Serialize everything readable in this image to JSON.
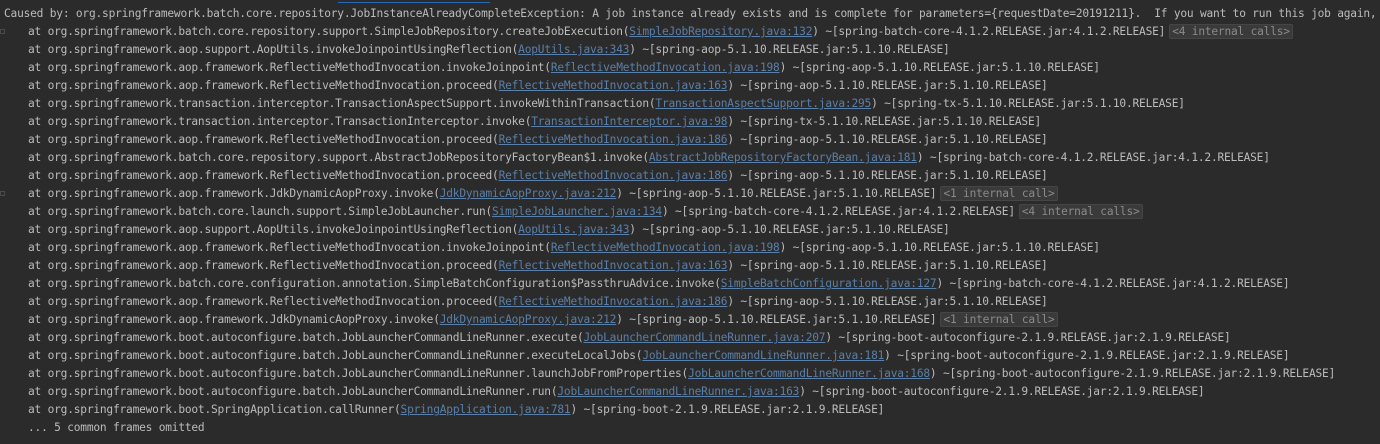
{
  "header": {
    "caused_by": "Caused by: org.springframework.batch.core.repository.JobInstanceAlreadyCompleteException: A job instance already exists and is complete for parameters={requestDate=20191211}.  If you want to run this job again, change the parameters."
  },
  "frames": [
    {
      "method": "at org.springframework.batch.core.repository.support.SimpleJobRepository.createJobExecution(",
      "link": "SimpleJobRepository.java:132",
      "jar": ") ~[spring-batch-core-4.1.2.RELEASE.jar:4.1.2.RELEASE]",
      "internal": "<4 internal calls>"
    },
    {
      "method": "at org.springframework.aop.support.AopUtils.invokeJoinpointUsingReflection(",
      "link": "AopUtils.java:343",
      "jar": ") ~[spring-aop-5.1.10.RELEASE.jar:5.1.10.RELEASE]",
      "internal": ""
    },
    {
      "method": "at org.springframework.aop.framework.ReflectiveMethodInvocation.invokeJoinpoint(",
      "link": "ReflectiveMethodInvocation.java:198",
      "jar": ") ~[spring-aop-5.1.10.RELEASE.jar:5.1.10.RELEASE]",
      "internal": ""
    },
    {
      "method": "at org.springframework.aop.framework.ReflectiveMethodInvocation.proceed(",
      "link": "ReflectiveMethodInvocation.java:163",
      "jar": ") ~[spring-aop-5.1.10.RELEASE.jar:5.1.10.RELEASE]",
      "internal": ""
    },
    {
      "method": "at org.springframework.transaction.interceptor.TransactionAspectSupport.invokeWithinTransaction(",
      "link": "TransactionAspectSupport.java:295",
      "jar": ") ~[spring-tx-5.1.10.RELEASE.jar:5.1.10.RELEASE]",
      "internal": ""
    },
    {
      "method": "at org.springframework.transaction.interceptor.TransactionInterceptor.invoke(",
      "link": "TransactionInterceptor.java:98",
      "jar": ") ~[spring-tx-5.1.10.RELEASE.jar:5.1.10.RELEASE]",
      "internal": ""
    },
    {
      "method": "at org.springframework.aop.framework.ReflectiveMethodInvocation.proceed(",
      "link": "ReflectiveMethodInvocation.java:186",
      "jar": ") ~[spring-aop-5.1.10.RELEASE.jar:5.1.10.RELEASE]",
      "internal": ""
    },
    {
      "method": "at org.springframework.batch.core.repository.support.AbstractJobRepositoryFactoryBean$1.invoke(",
      "link": "AbstractJobRepositoryFactoryBean.java:181",
      "jar": ") ~[spring-batch-core-4.1.2.RELEASE.jar:4.1.2.RELEASE]",
      "internal": ""
    },
    {
      "method": "at org.springframework.aop.framework.ReflectiveMethodInvocation.proceed(",
      "link": "ReflectiveMethodInvocation.java:186",
      "jar": ") ~[spring-aop-5.1.10.RELEASE.jar:5.1.10.RELEASE]",
      "internal": ""
    },
    {
      "method": "at org.springframework.aop.framework.JdkDynamicAopProxy.invoke(",
      "link": "JdkDynamicAopProxy.java:212",
      "jar": ") ~[spring-aop-5.1.10.RELEASE.jar:5.1.10.RELEASE]",
      "internal": "<1 internal call>"
    },
    {
      "method": "at org.springframework.batch.core.launch.support.SimpleJobLauncher.run(",
      "link": "SimpleJobLauncher.java:134",
      "jar": ") ~[spring-batch-core-4.1.2.RELEASE.jar:4.1.2.RELEASE]",
      "internal": "<4 internal calls>"
    },
    {
      "method": "at org.springframework.aop.support.AopUtils.invokeJoinpointUsingReflection(",
      "link": "AopUtils.java:343",
      "jar": ") ~[spring-aop-5.1.10.RELEASE.jar:5.1.10.RELEASE]",
      "internal": ""
    },
    {
      "method": "at org.springframework.aop.framework.ReflectiveMethodInvocation.invokeJoinpoint(",
      "link": "ReflectiveMethodInvocation.java:198",
      "jar": ") ~[spring-aop-5.1.10.RELEASE.jar:5.1.10.RELEASE]",
      "internal": ""
    },
    {
      "method": "at org.springframework.aop.framework.ReflectiveMethodInvocation.proceed(",
      "link": "ReflectiveMethodInvocation.java:163",
      "jar": ") ~[spring-aop-5.1.10.RELEASE.jar:5.1.10.RELEASE]",
      "internal": ""
    },
    {
      "method": "at org.springframework.batch.core.configuration.annotation.SimpleBatchConfiguration$PassthruAdvice.invoke(",
      "link": "SimpleBatchConfiguration.java:127",
      "jar": ") ~[spring-batch-core-4.1.2.RELEASE.jar:4.1.2.RELEASE]",
      "internal": ""
    },
    {
      "method": "at org.springframework.aop.framework.ReflectiveMethodInvocation.proceed(",
      "link": "ReflectiveMethodInvocation.java:186",
      "jar": ") ~[spring-aop-5.1.10.RELEASE.jar:5.1.10.RELEASE]",
      "internal": ""
    },
    {
      "method": "at org.springframework.aop.framework.JdkDynamicAopProxy.invoke(",
      "link": "JdkDynamicAopProxy.java:212",
      "jar": ") ~[spring-aop-5.1.10.RELEASE.jar:5.1.10.RELEASE]",
      "internal": "<1 internal call>"
    },
    {
      "method": "at org.springframework.boot.autoconfigure.batch.JobLauncherCommandLineRunner.execute(",
      "link": "JobLauncherCommandLineRunner.java:207",
      "jar": ") ~[spring-boot-autoconfigure-2.1.9.RELEASE.jar:2.1.9.RELEASE]",
      "internal": ""
    },
    {
      "method": "at org.springframework.boot.autoconfigure.batch.JobLauncherCommandLineRunner.executeLocalJobs(",
      "link": "JobLauncherCommandLineRunner.java:181",
      "jar": ") ~[spring-boot-autoconfigure-2.1.9.RELEASE.jar:2.1.9.RELEASE]",
      "internal": ""
    },
    {
      "method": "at org.springframework.boot.autoconfigure.batch.JobLauncherCommandLineRunner.launchJobFromProperties(",
      "link": "JobLauncherCommandLineRunner.java:168",
      "jar": ") ~[spring-boot-autoconfigure-2.1.9.RELEASE.jar:2.1.9.RELEASE]",
      "internal": ""
    },
    {
      "method": "at org.springframework.boot.autoconfigure.batch.JobLauncherCommandLineRunner.run(",
      "link": "JobLauncherCommandLineRunner.java:163",
      "jar": ") ~[spring-boot-autoconfigure-2.1.9.RELEASE.jar:2.1.9.RELEASE]",
      "internal": ""
    },
    {
      "method": "at org.springframework.boot.SpringApplication.callRunner(",
      "link": "SpringApplication.java:781",
      "jar": ") ~[spring-boot-2.1.9.RELEASE.jar:2.1.9.RELEASE]",
      "internal": ""
    }
  ],
  "footer": {
    "omitted": "... 5 common frames omitted"
  },
  "colors": {
    "background": "#2b2b2b",
    "text": "#bbbbbb",
    "link": "#5a7fa8",
    "internal_badge_bg": "#3a3a3a"
  }
}
